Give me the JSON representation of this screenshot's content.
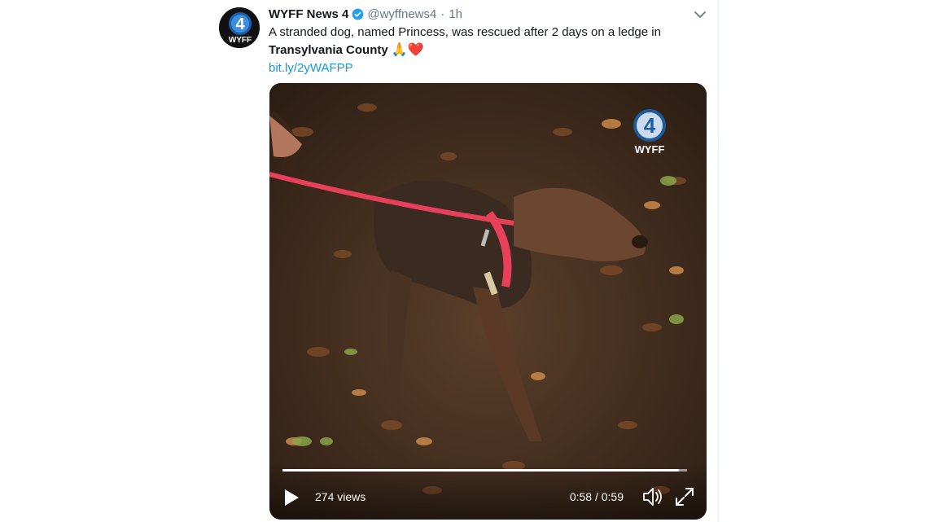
{
  "tweet": {
    "display_name": "WYFF News 4",
    "handle": "@wyffnews4",
    "separator": "·",
    "timestamp": "1h",
    "text_before": "A stranded dog, named Princess, was rescued after 2 days on a ledge in",
    "bold_place": "Transylvania County",
    "emojis": "🙏❤️",
    "link": "bit.ly/2yWAFPP",
    "avatar_logo_text": "WYFF",
    "avatar_logo_number": "4"
  },
  "video": {
    "watermark_number": "4",
    "watermark_text": "WYFF",
    "views": "274 views",
    "time": "0:58 / 0:59",
    "progress_fraction": 0.98
  },
  "icons": {
    "verified": "verified-badge-icon",
    "caret": "chevron-down-icon",
    "play": "play-icon",
    "volume": "volume-icon",
    "fullscreen": "fullscreen-icon"
  },
  "colors": {
    "link": "#1b95e0",
    "verified": "#1da1f2",
    "leash": "#e8405a",
    "text": "#14171a",
    "muted": "#657786"
  }
}
